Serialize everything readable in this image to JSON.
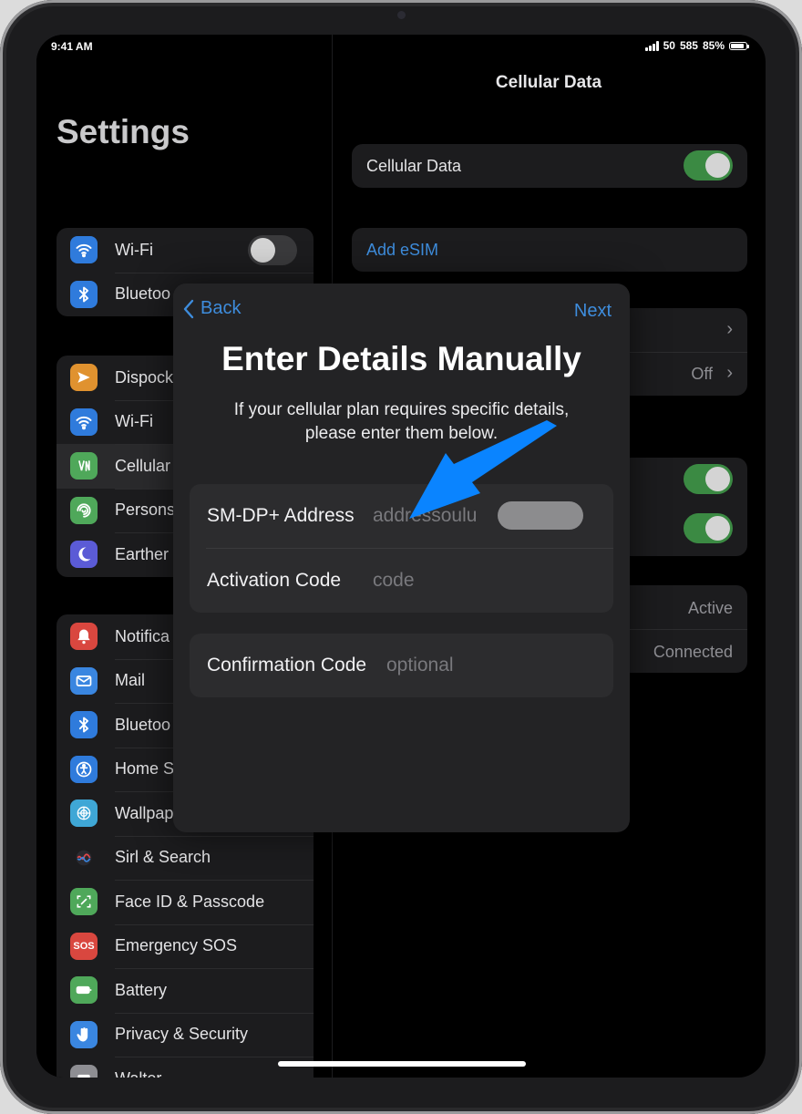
{
  "status_bar": {
    "time": "9:41 AM",
    "network": "50",
    "extra": "585",
    "battery": "85%"
  },
  "sidebar": {
    "title": "Settings",
    "group1": [
      {
        "label": "Wi-Fi",
        "icon": "wifi-icon",
        "color": "#2f7bdc",
        "toggle": "off"
      },
      {
        "label": "Bluetoo",
        "icon": "bluetooth-icon",
        "color": "#2f7bdc"
      }
    ],
    "group2": [
      {
        "label": "Dispock",
        "icon": "airplane-icon",
        "color": "#e0922f"
      },
      {
        "label": "Wi-Fi",
        "icon": "wifi-icon",
        "color": "#2f7bdc"
      },
      {
        "label": "Cellular",
        "icon": "cellular-icon",
        "color": "#4fa85a",
        "selected": true
      },
      {
        "label": "Persons",
        "icon": "hotspot-icon",
        "color": "#4fa85a"
      },
      {
        "label": "Earther",
        "icon": "moon-icon",
        "color": "#5b5bd6"
      }
    ],
    "group3": [
      {
        "label": "Notifica",
        "icon": "notification-icon",
        "color": "#d9473f"
      },
      {
        "label": "Mail",
        "icon": "mail-icon",
        "color": "#3a86e0"
      },
      {
        "label": "Bluetoo",
        "icon": "bluetooth-icon",
        "color": "#2f7bdc"
      },
      {
        "label": "Home S",
        "icon": "accessibility-icon",
        "color": "#2f7bdc"
      },
      {
        "label": "Wallpap",
        "icon": "wallpaper-icon",
        "color": "#3fa7d6"
      },
      {
        "label": "Sirl & Search",
        "icon": "siri-icon",
        "color": "#1c1c1e"
      },
      {
        "label": "Face ID & Passcode",
        "icon": "faceid-icon",
        "color": "#4fa85a"
      },
      {
        "label": "Emergency SOS",
        "icon": "sos-icon",
        "color": "#d9473f",
        "icon_text": "SOS"
      },
      {
        "label": "Battery",
        "icon": "battery-icon",
        "color": "#4fa85a"
      },
      {
        "label": "Privacy & Security",
        "icon": "hand-icon",
        "color": "#3a86e0"
      },
      {
        "label": "Walter",
        "icon": "wallet-icon",
        "color": "#8e8e93"
      }
    ]
  },
  "detail": {
    "title": "Cellular Data",
    "cellular_data_label": "Cellular Data",
    "cellular_data_toggle": "on",
    "add_esim": "Add eSIM",
    "row_off_value": "Off",
    "status_active": "Active",
    "status_connected": "Connected",
    "toggle_colors": {
      "on": "#3b8a43",
      "off": "#3a3a3c"
    }
  },
  "modal": {
    "back_label": "Back",
    "next_label": "Next",
    "title": "Enter Details Manually",
    "subtitle": "If your cellular plan requires specific details, please enter them below.",
    "fields": [
      {
        "label": "SM-DP+ Address",
        "value": "addressoulu"
      },
      {
        "label": "Activation Code",
        "placeholder": "code"
      },
      {
        "label": "Confirmation Code",
        "placeholder": "optional"
      }
    ],
    "accent": "#3e8ddd",
    "annotation_arrow_color": "#0a84ff"
  }
}
